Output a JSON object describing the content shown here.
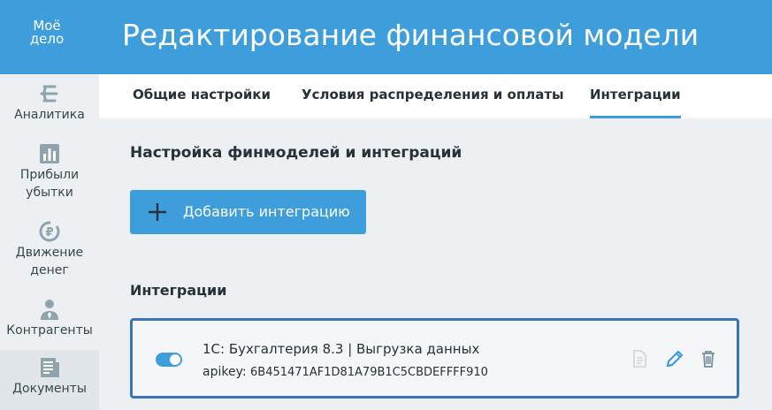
{
  "header": {
    "logo_line1": "Моё",
    "logo_line2": "дело",
    "title": "Редактирование финансовой модели"
  },
  "sidebar": {
    "items": [
      {
        "label": "Аналитика",
        "icon": "analytics-icon"
      },
      {
        "label": "Прибыли убытки",
        "icon": "bar-chart-icon"
      },
      {
        "label": "Движение денег",
        "icon": "money-flow-icon"
      },
      {
        "label": "Контрагенты",
        "icon": "person-icon"
      },
      {
        "label": "Документы",
        "icon": "documents-icon"
      }
    ]
  },
  "tabs": [
    {
      "label": "Общие настройки"
    },
    {
      "label": "Условия распределения и оплаты"
    },
    {
      "label": "Интеграции",
      "active": true
    }
  ],
  "main": {
    "section_title": "Настройка финмоделей и интеграций",
    "add_button_label": "Добавить интеграцию",
    "integrations_title": "Интеграции"
  },
  "integration": {
    "enabled": true,
    "name": "1С: Бухгалтерия 8.3 | Выгрузка данных",
    "apikey_label": "apikey:",
    "apikey_value": "6B451471AF1D81A79B1C5CBDEFFFF910"
  },
  "colors": {
    "header": "#3e9edc",
    "accent": "#3e9edc",
    "card_border": "#3a74b3",
    "background": "#ecf0f3"
  }
}
